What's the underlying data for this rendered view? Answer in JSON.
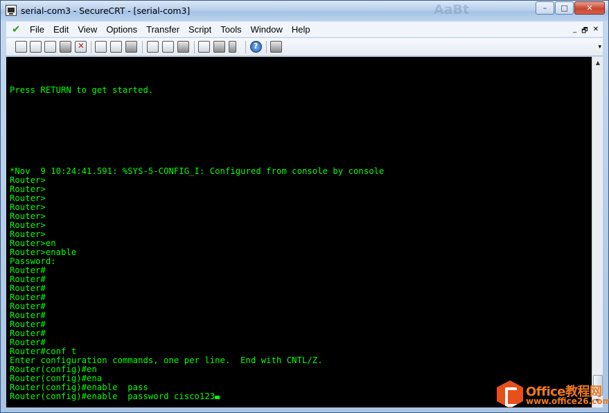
{
  "window": {
    "title": "serial-com3 - SecureCRT - [serial-com3]",
    "ghost_text": "AaBt",
    "controls": {
      "minimize": "–",
      "maximize": "□",
      "close": "✕"
    }
  },
  "menu": {
    "items": [
      "File",
      "Edit",
      "View",
      "Options",
      "Transfer",
      "Script",
      "Tools",
      "Window",
      "Help"
    ],
    "mdi_controls": {
      "minimize": "_",
      "restore": "🗗",
      "close": "✕"
    }
  },
  "toolbar": {
    "icons": [
      "connect-icon",
      "quick-connect-icon",
      "connect-tab-icon",
      "reconnect-icon",
      "disconnect-icon",
      "copy-icon",
      "paste-icon",
      "find-icon",
      "print-icon",
      "print-selection-icon",
      "print-setup-icon",
      "session-options-icon",
      "global-options-icon",
      "keymap-icon",
      "help-icon",
      "about-icon"
    ],
    "overflow": "▾"
  },
  "terminal": {
    "lines": [
      "",
      "",
      "",
      "Press RETURN to get started.",
      "",
      "",
      "",
      "",
      "",
      "",
      "",
      "",
      "*Nov  9 10:24:41.591: %SYS-5-CONFIG_I: Configured from console by console",
      "Router>",
      "Router>",
      "Router>",
      "Router>",
      "Router>",
      "Router>",
      "Router>",
      "Router>en",
      "Router>enable",
      "Password:",
      "Router#",
      "Router#",
      "Router#",
      "Router#",
      "Router#",
      "Router#",
      "Router#",
      "Router#",
      "Router#",
      "Router#conf t",
      "Enter configuration commands, one per line.  End with CNTL/Z.",
      "Router(config)#en",
      "Router(config)#ena",
      "Router(config)#enable  pass",
      "Router(config)#enable  password cisco123"
    ],
    "text_color": "#00ff00",
    "background": "#000000"
  },
  "scrollbar": {
    "up": "▲",
    "down": "▼"
  },
  "watermark": {
    "title": "Office教程网",
    "url": "www.office26.com",
    "color": "#f07a1f"
  }
}
